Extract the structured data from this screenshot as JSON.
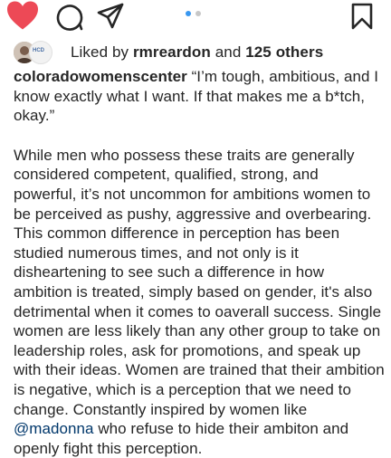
{
  "action_bar": {
    "icons": {
      "like": "heart-filled-icon",
      "comment": "comment-icon",
      "share": "paper-plane-icon",
      "save": "bookmark-icon"
    },
    "like_color": "#ed4956",
    "carousel": {
      "total": 2,
      "active_index": 0,
      "active_color": "#3897f0"
    }
  },
  "likes": {
    "prefix": "Liked by ",
    "user": "rmreardon",
    "middle": " and ",
    "others": "125 others",
    "avatar_2_label": "HCD"
  },
  "post": {
    "username": "coloradowomenscenter",
    "quote": " “I’m tough, ambitious, and I know exactly what I want. If that makes me a b*tch, okay.”",
    "body_before_mention": "While men who possess these traits are generally considered competent, qualified, strong, and powerful, it’s not uncommon for ambitions women to be perceived as pushy, aggressive and overbearing. This common difference in perception has been studied numerous times, and not only is it disheartening to see such a difference in how ambition is treated, simply based on gender, it's also detrimental when it comes to oaverall success. Single women are less likely than any other group to take on leadership roles, ask for promotions, and speak up with their ideas. Women are trained that their ambition is negative, which is a perception that we need to change. Constantly inspired by women like ",
    "mention": "@madonna",
    "body_after_mention": " who refuse to hide their ambiton and openly fight this perception."
  }
}
